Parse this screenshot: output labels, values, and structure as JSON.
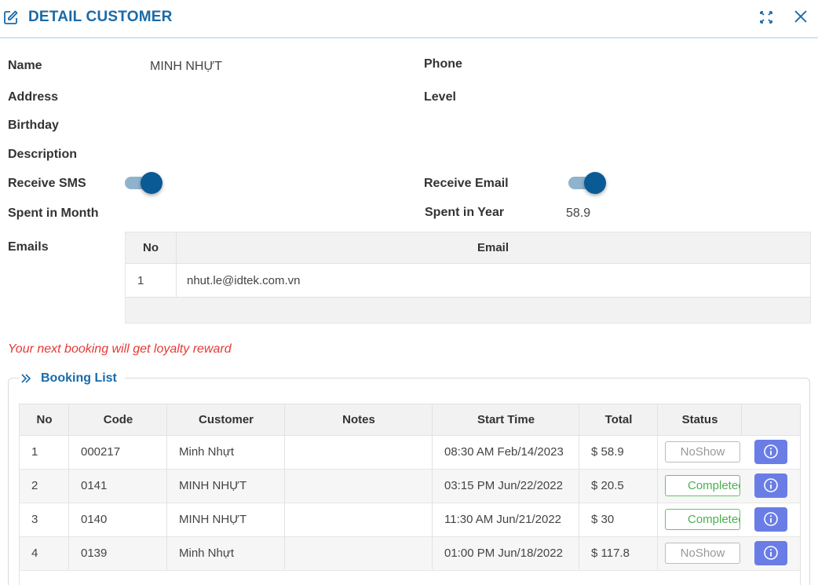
{
  "dialog": {
    "title": "DETAIL CUSTOMER"
  },
  "customer": {
    "name_label": "Name",
    "name_value": "MINH NHỰT",
    "phone_label": "Phone",
    "address_label": "Address",
    "level_label": "Level",
    "birthday_label": "Birthday",
    "description_label": "Description",
    "receive_sms_label": "Receive SMS",
    "receive_sms_on": true,
    "receive_email_label": "Receive Email",
    "receive_email_on": true,
    "spent_month_label": "Spent in Month",
    "spent_year_label": "Spent in Year",
    "spent_year_value": "58.9",
    "emails_label": "Emails"
  },
  "emails_table": {
    "headers": [
      "No",
      "Email"
    ],
    "rows": [
      {
        "no": "1",
        "email": "nhut.le@idtek.com.vn"
      }
    ]
  },
  "loyalty_message": "Your next booking will get loyalty reward",
  "booking_list": {
    "title": "Booking List",
    "headers": [
      "No",
      "Code",
      "Customer",
      "Notes",
      "Start Time",
      "Total",
      "Status",
      ""
    ],
    "rows": [
      {
        "no": "1",
        "code": "000217",
        "customer": "Minh Nhựt",
        "notes": "",
        "start_time": "08:30 AM Feb/14/2023",
        "total": "$ 58.9",
        "status": "NoShow"
      },
      {
        "no": "2",
        "code": "0141",
        "customer": "MINH NHỰT",
        "notes": "",
        "start_time": "03:15 PM Jun/22/2022",
        "total": "$ 20.5",
        "status": "Completed"
      },
      {
        "no": "3",
        "code": "0140",
        "customer": "MINH NHỰT",
        "notes": "",
        "start_time": "11:30 AM Jun/21/2022",
        "total": "$ 30",
        "status": "Completed"
      },
      {
        "no": "4",
        "code": "0139",
        "customer": "Minh Nhựt",
        "notes": "",
        "start_time": "01:00 PM Jun/18/2022",
        "total": "$ 117.8",
        "status": "NoShow"
      }
    ]
  },
  "colors": {
    "accent": "#1a6aa8",
    "toggle_on": "#0a5a96",
    "loyalty_text": "#e53935",
    "completed": "#4caf50",
    "info_button": "#6a7de6"
  },
  "icons": {
    "header_left": "edit-icon",
    "header_expand": "expand-icon",
    "header_close": "close-icon",
    "legend": "double-chevron-icon",
    "row_action": "info-icon"
  }
}
